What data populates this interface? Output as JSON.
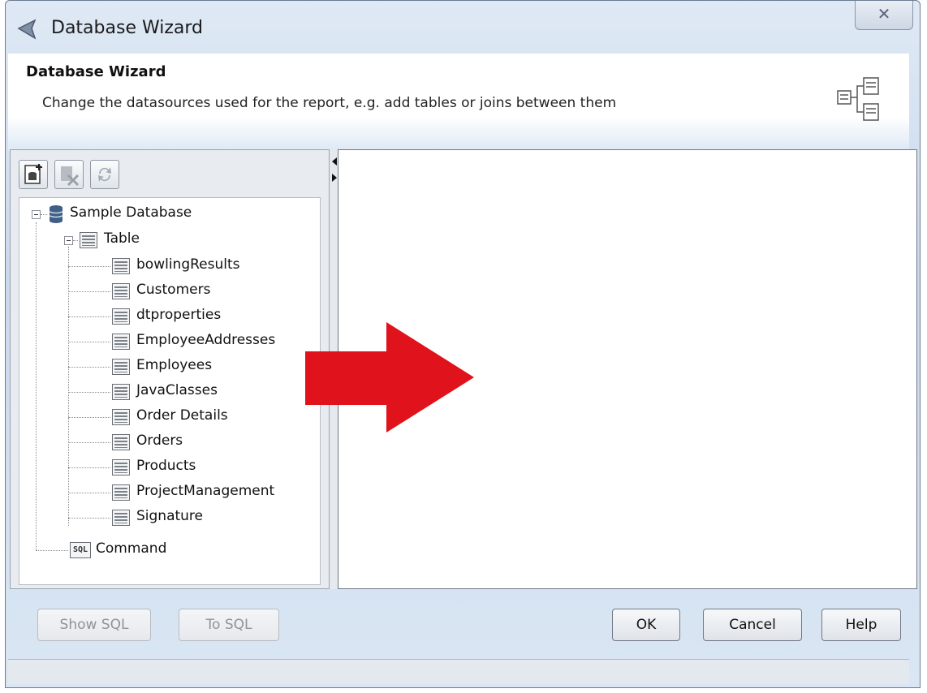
{
  "window": {
    "title": "Database Wizard",
    "close_glyph": "✕"
  },
  "header": {
    "title": "Database Wizard",
    "subtitle": "Change the datasources used for the report, e.g. add tables or joins between them",
    "icon": "datasource-join-icon"
  },
  "toolbar": {
    "buttons": [
      {
        "name": "add-datasource-button",
        "icon": "add-database-icon",
        "enabled": true
      },
      {
        "name": "remove-datasource-button",
        "icon": "remove-icon",
        "enabled": false
      },
      {
        "name": "refresh-button",
        "icon": "refresh-icon",
        "enabled": false
      }
    ]
  },
  "tree": {
    "root": "Sample Database",
    "table_group": "Table",
    "tables": [
      "bowlingResults",
      "Customers",
      "dtproperties",
      "EmployeeAddresses",
      "Employees",
      "JavaClasses",
      "Order Details",
      "Orders",
      "Products",
      "ProjectManagement",
      "Signature"
    ],
    "command": "Command",
    "command_icon_text": "SQL"
  },
  "footer": {
    "show_sql": "Show SQL",
    "to_sql": "To SQL",
    "ok": "OK",
    "cancel": "Cancel",
    "help": "Help"
  },
  "annotation": {
    "arrow_color": "#e0121b"
  }
}
